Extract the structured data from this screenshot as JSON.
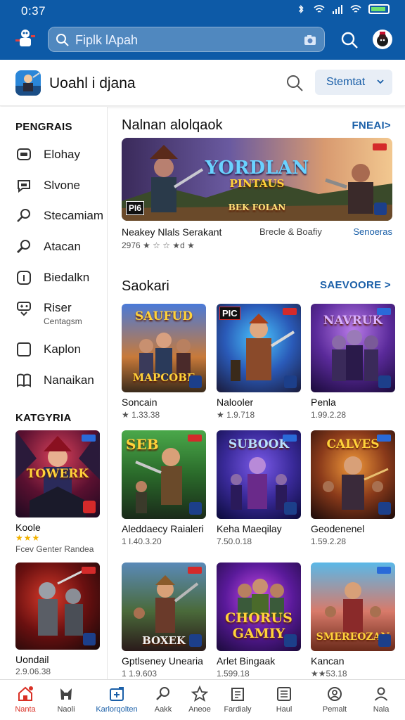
{
  "status": {
    "time": "0:37"
  },
  "search": {
    "placeholder": "Fiplk lApah"
  },
  "header": {
    "title": "Uoahl i djana",
    "dropdown": "Stemtat"
  },
  "sidebar": {
    "section1": "PENGRAIS",
    "items": [
      {
        "label": "Elohay",
        "icon": "message-icon"
      },
      {
        "label": "Slvone",
        "icon": "chat-icon"
      },
      {
        "label": "Stecamiam",
        "icon": "search-icon"
      },
      {
        "label": "Atacan",
        "icon": "magnifier-icon"
      },
      {
        "label": "Biedalkn",
        "icon": "info-icon"
      },
      {
        "label": "Riser",
        "sublabel": "Centagsm",
        "icon": "gamepad-icon"
      },
      {
        "label": "Kaplon",
        "icon": "square-icon"
      },
      {
        "label": "Nanaikan",
        "icon": "book-icon"
      }
    ],
    "section2": "KATGYRIA",
    "cards": [
      {
        "title": "TOWERK",
        "name": "Koole",
        "stars": "★★★",
        "meta": "Fcev Genter Randea"
      },
      {
        "title": "",
        "name": "Uondail",
        "meta": "2.9.06.38"
      }
    ]
  },
  "featured": {
    "title": "Nalnan alolqaok",
    "link": "FNEAI>",
    "banner_title": "YORDLAN",
    "banner_subtitle": "PINTAUS",
    "banner_tag": "BEK FOLAN",
    "banner_corner": "PI6",
    "name": "Neakey Nlals Serakant",
    "developer": "Brecle & Boafiy",
    "link2": "Senoeras",
    "meta": "2976 ★ ☆ ☆ ★d ★"
  },
  "section2": {
    "title": "Saokari",
    "link": "SAEVOORE >"
  },
  "games": [
    {
      "name": "Soncain",
      "meta": "★ 1.33.38",
      "art": "MAPCOBE"
    },
    {
      "name": "Nalooler",
      "meta": "★ 1.9.718",
      "art": "PIC"
    },
    {
      "name": "Penla",
      "meta": "1.99.2.28",
      "art": ""
    },
    {
      "name": "Aleddaecy Raialeri",
      "meta": "1 I.40.3.20",
      "art": "SEB"
    },
    {
      "name": "Keha Maeqilay",
      "meta": "7.50.0.18",
      "art": "SUBOOK"
    },
    {
      "name": "Geodenenel",
      "meta": "1.59.2.28",
      "art": "CALVES"
    },
    {
      "name": "Gptlseney Unearia",
      "meta": "1 1.9.603",
      "art": "BOXEK"
    },
    {
      "name": "Arlet Bingaak",
      "meta": "1.599.18",
      "art": "CHORUS GAMIY"
    },
    {
      "name": "Kancan",
      "meta": "★★53.18",
      "art": "SMEREOZAN"
    }
  ],
  "nav": [
    {
      "label": "Nanta",
      "icon": "home-icon"
    },
    {
      "label": "Naoli",
      "icon": "gamepad-icon"
    },
    {
      "label": "Karlorqolten",
      "icon": "apps-icon"
    },
    {
      "label": "Aakk",
      "icon": "search-icon"
    },
    {
      "label": "Aneoe",
      "icon": "star-icon"
    },
    {
      "label": "Fardialy",
      "icon": "library-icon"
    },
    {
      "label": "Haul",
      "icon": "list-icon"
    },
    {
      "label": "Pemalt",
      "icon": "profile-ring-icon"
    },
    {
      "label": "Nala",
      "icon": "person-icon"
    }
  ],
  "colors": {
    "topbar": "#0d5aa7",
    "accent": "#1a5fa8",
    "active_nav": "#d93025",
    "star": "#f2b200"
  }
}
